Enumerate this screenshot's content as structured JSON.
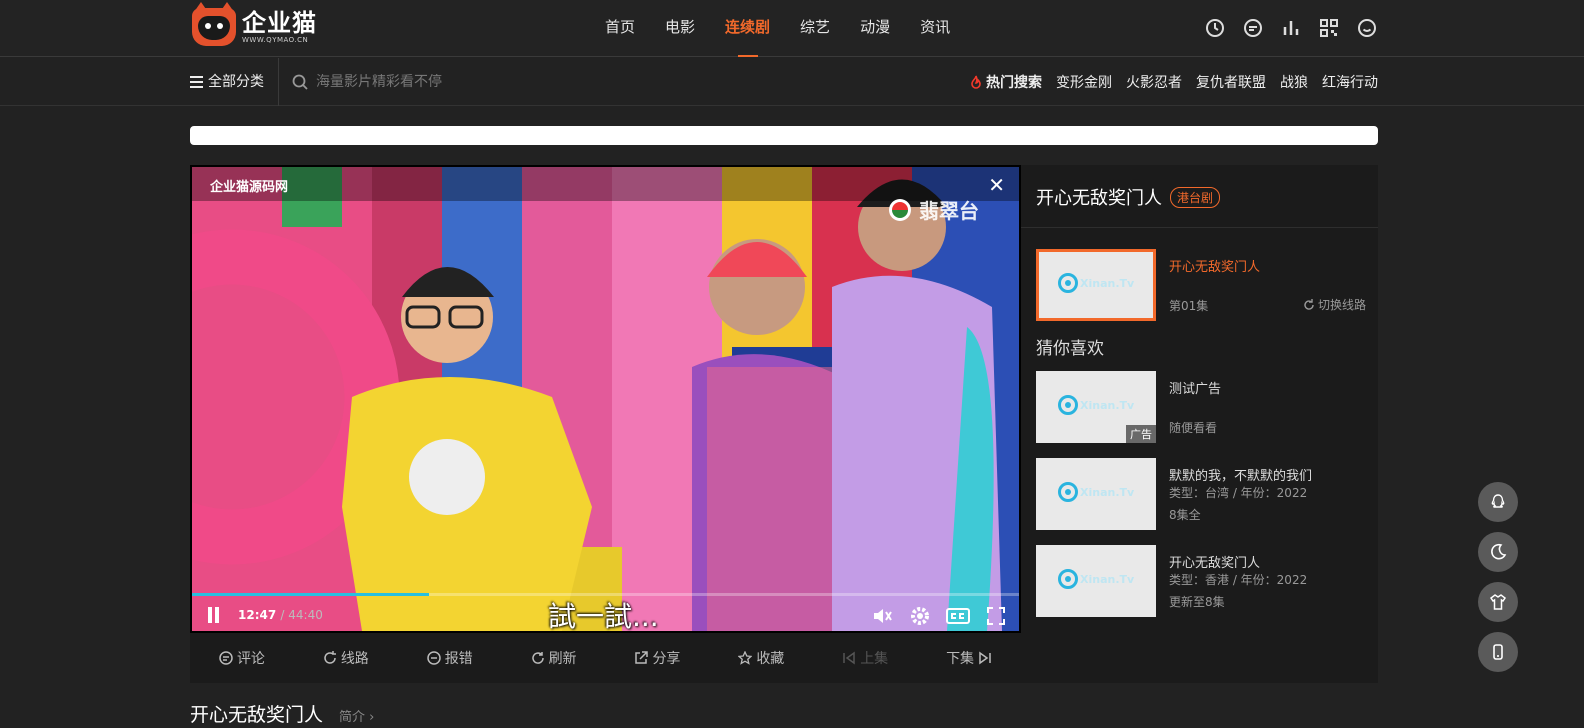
{
  "brand": {
    "name": "企业猫",
    "url": "WWW.QYMAO.CN"
  },
  "nav": [
    {
      "label": "首页",
      "active": false
    },
    {
      "label": "电影",
      "active": false
    },
    {
      "label": "连续剧",
      "active": true
    },
    {
      "label": "综艺",
      "active": false
    },
    {
      "label": "动漫",
      "active": false
    },
    {
      "label": "资讯",
      "active": false
    }
  ],
  "header_icons": [
    "clock-icon",
    "chat-icon",
    "ranking-icon",
    "qrcode-icon",
    "user-face-icon"
  ],
  "subbar": {
    "all_categories": "全部分类",
    "search_placeholder": "海量影片精彩看不停",
    "hot_title": "热门搜索",
    "hot_links": [
      "变形金刚",
      "火影忍者",
      "复仇者联盟",
      "战狼",
      "红海行动"
    ]
  },
  "player": {
    "title": "企业猫源码网",
    "watermark": "翡翠台",
    "subtitle": "試一試...",
    "current_time": "12:47",
    "duration": "44:40",
    "progress_fraction": 0.286
  },
  "actions": [
    {
      "label": "评论",
      "icon": "comment-icon",
      "disabled": false
    },
    {
      "label": "线路",
      "icon": "route-icon",
      "disabled": false
    },
    {
      "label": "报错",
      "icon": "error-icon",
      "disabled": false
    },
    {
      "label": "刷新",
      "icon": "refresh-icon",
      "disabled": false
    },
    {
      "label": "分享",
      "icon": "share-icon",
      "disabled": false
    },
    {
      "label": "收藏",
      "icon": "star-icon",
      "disabled": false
    },
    {
      "label": "上集",
      "icon": "prev-icon",
      "disabled": true
    },
    {
      "label": "下集",
      "icon": "next-icon",
      "disabled": false
    }
  ],
  "panel": {
    "title": "开心无敌奖门人",
    "tag": "港台剧",
    "current": {
      "title": "开心无敌奖门人",
      "episode": "第01集",
      "switch_label": "切换线路",
      "thumb_text": "Xinan.Tv"
    },
    "section_title": "猜你喜欢",
    "recommendations": [
      {
        "title": "测试广告",
        "line1": "",
        "line2": "随便看看",
        "ad": "广告",
        "thumb_text": "Xinan.Tv"
      },
      {
        "title": "默默的我，不默默的我们",
        "line1": "类型：台湾 / 年份：2022",
        "line2": "8集全",
        "ad": "",
        "thumb_text": "Xinan.Tv"
      },
      {
        "title": "开心无敌奖门人",
        "line1": "类型：香港 / 年份：2022",
        "line2": "更新至8集",
        "ad": "",
        "thumb_text": "Xinan.Tv"
      }
    ]
  },
  "bottom": {
    "title": "开心无敌奖门人",
    "intro": "简介 ›"
  },
  "colors": {
    "accent": "#f2692b",
    "background": "#222222",
    "progress": "#27c0e0"
  }
}
